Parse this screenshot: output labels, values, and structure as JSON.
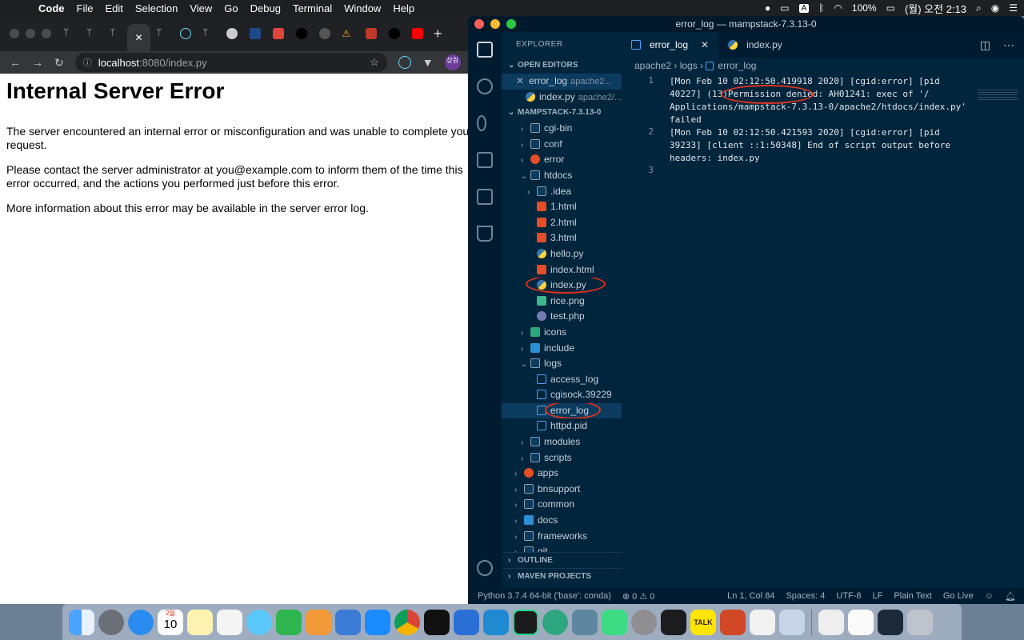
{
  "menubar": {
    "app": "Code",
    "items": [
      "File",
      "Edit",
      "Selection",
      "View",
      "Go",
      "Debug",
      "Terminal",
      "Window",
      "Help"
    ],
    "ime": "A",
    "battery": "100%",
    "clock": "(월) 오전 2:13"
  },
  "browser": {
    "url_host": "localhost",
    "url_rest": ":8080/index.py",
    "profile": "상원",
    "page_title": "Internal Server Error",
    "paragraphs": [
      "The server encountered an internal error or misconfiguration and was unable to complete your request.",
      "Please contact the server administrator at you@example.com to inform them of the time this error occurred, and the actions you performed just before this error.",
      "More information about this error may be available in the server error log."
    ]
  },
  "vscode": {
    "title": "error_log — mampstack-7.3.13-0",
    "explorer_label": "EXPLORER",
    "open_editors_label": "OPEN EDITORS",
    "open_editors": [
      {
        "name": "error_log",
        "path": "apache2..."
      },
      {
        "name": "index.py",
        "path": "apache2/..."
      }
    ],
    "workspace_label": "MAMPSTACK-7.3.13-0",
    "tree": [
      {
        "label": "cgi-bin"
      },
      {
        "label": "conf"
      },
      {
        "label": "error"
      },
      {
        "label": "htdocs"
      },
      {
        "label": ".idea"
      },
      {
        "label": "1.html"
      },
      {
        "label": "2.html"
      },
      {
        "label": "3.html"
      },
      {
        "label": "hello.py"
      },
      {
        "label": "index.html"
      },
      {
        "label": "index.py"
      },
      {
        "label": "rice.png"
      },
      {
        "label": "test.php"
      },
      {
        "label": "icons"
      },
      {
        "label": "include"
      },
      {
        "label": "logs"
      },
      {
        "label": "access_log"
      },
      {
        "label": "cgisock.39229"
      },
      {
        "label": "error_log"
      },
      {
        "label": "httpd.pid"
      },
      {
        "label": "modules"
      },
      {
        "label": "scripts"
      },
      {
        "label": "apps"
      },
      {
        "label": "bnsupport"
      },
      {
        "label": "common"
      },
      {
        "label": "docs"
      },
      {
        "label": "frameworks"
      },
      {
        "label": "git"
      }
    ],
    "outline_label": "OUTLINE",
    "maven_label": "MAVEN PROJECTS",
    "tabs": [
      {
        "label": "error_log"
      },
      {
        "label": "index.py"
      }
    ],
    "breadcrumb": [
      "apache2",
      "logs",
      "error_log"
    ],
    "code_lines": [
      {
        "num": "1",
        "text": "[Mon Feb 10 02:12:50.419918 2020] [cgid:error] [pid\n40227] (13)Permission denied: AH01241: exec of '/\nApplications/mampstack-7.3.13-0/apache2/htdocs/index.py'\nfailed"
      },
      {
        "num": "2",
        "text": "[Mon Feb 10 02:12:50.421593 2020] [cgid:error] [pid\n39233] [client ::1:50348] End of script output before\nheaders: index.py"
      },
      {
        "num": "3",
        "text": ""
      }
    ],
    "status": {
      "python": "Python 3.7.4 64-bit ('base': conda)",
      "problems": "⊗ 0 ⚠ 0",
      "position": "Ln 1, Col 84",
      "spaces": "Spaces: 4",
      "encoding": "UTF-8",
      "eol": "LF",
      "language": "Plain Text",
      "golive": "Go Live"
    }
  },
  "dock": {
    "calendar_day": "10",
    "calendar_month": "2월",
    "talk": "TALK"
  }
}
